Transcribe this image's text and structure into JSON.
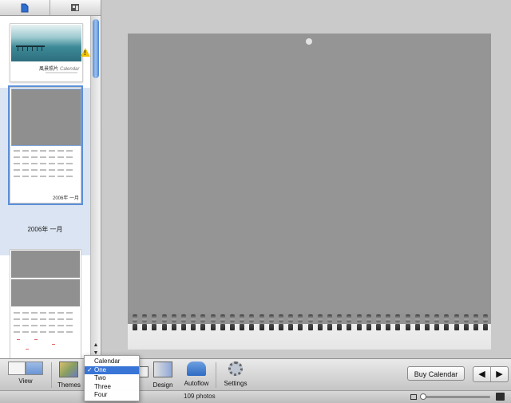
{
  "sidebar": {
    "cover": {
      "title": "風景照片",
      "subtitle": "Calendar",
      "warning_icon": "warning-icon"
    },
    "pages": [
      {
        "caption": "2006年 一月",
        "thumb_label": "2006年 一月"
      }
    ]
  },
  "toolbar": {
    "view_label": "View",
    "themes_label": "Themes",
    "design_label": "Design",
    "autoflow_label": "Autoflow",
    "settings_label": "Settings",
    "buy_label": "Buy Calendar",
    "prev_icon": "arrow-left-icon",
    "next_icon": "arrow-right-icon"
  },
  "layout_menu": {
    "items": [
      {
        "label": "Calendar",
        "selected": false
      },
      {
        "label": "One",
        "selected": true
      },
      {
        "label": "Two",
        "selected": false
      },
      {
        "label": "Three",
        "selected": false
      },
      {
        "label": "Four",
        "selected": false
      }
    ]
  },
  "status": {
    "photo_count": "109 photos"
  },
  "colors": {
    "selection": "#3875d7",
    "accent": "#5c8fd9",
    "warning": "#f2c200"
  }
}
